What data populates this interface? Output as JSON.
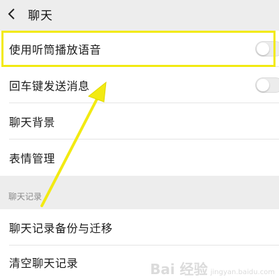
{
  "header": {
    "back_icon": "chevron-left-icon",
    "title": "聊天"
  },
  "settings": {
    "use_earpiece_label": "使用听筒播放语音",
    "use_earpiece_on": false,
    "enter_to_send_label": "回车键发送消息",
    "enter_to_send_on": false,
    "chat_background_label": "聊天背景",
    "emoji_management_label": "表情管理"
  },
  "section": {
    "chat_history_header": "聊天记录"
  },
  "history": {
    "backup_migrate_label": "聊天记录备份与迁移",
    "clear_history_label": "清空聊天记录"
  },
  "overlay": {
    "highlight_color": "#f2ea12",
    "arrow_color": "#f2ea12",
    "watermark_logo": "Bai 经验",
    "watermark_url": "jingyan.baidu.com"
  }
}
